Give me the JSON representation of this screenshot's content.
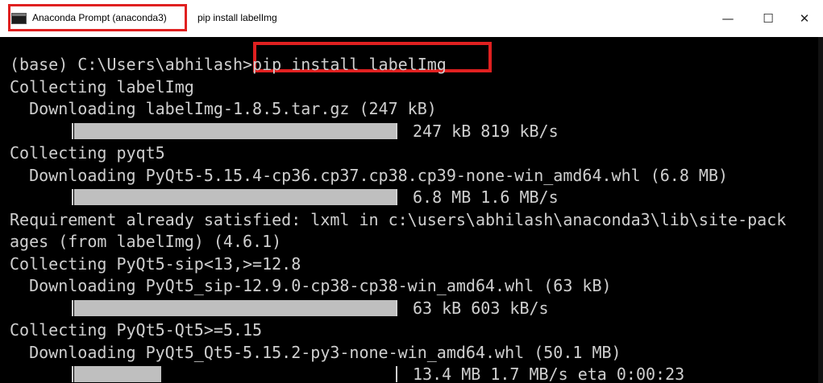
{
  "window": {
    "tab_title": "Anaconda Prompt (anaconda3)",
    "subtitle": "pip  install labelImg",
    "controls": {
      "minimize": "—",
      "maximize": "☐",
      "close": "✕"
    }
  },
  "terminal": {
    "lines": [
      {
        "type": "text",
        "text": "(base) C:\\Users\\abhilash>pip install labelImg"
      },
      {
        "type": "text",
        "text": "Collecting labelImg"
      },
      {
        "type": "text",
        "text": "  Downloading labelImg-1.8.5.tar.gz (247 kB)"
      },
      {
        "type": "progress",
        "fill": 1.0,
        "info": "247 kB 819 kB/s"
      },
      {
        "type": "text",
        "text": "Collecting pyqt5"
      },
      {
        "type": "text",
        "text": "  Downloading PyQt5-5.15.4-cp36.cp37.cp38.cp39-none-win_amd64.whl (6.8 MB)"
      },
      {
        "type": "progress",
        "fill": 1.0,
        "info": "6.8 MB 1.6 MB/s"
      },
      {
        "type": "text",
        "text": "Requirement already satisfied: lxml in c:\\users\\abhilash\\anaconda3\\lib\\site-pack"
      },
      {
        "type": "text",
        "text": "ages (from labelImg) (4.6.1)"
      },
      {
        "type": "text",
        "text": "Collecting PyQt5-sip<13,>=12.8"
      },
      {
        "type": "text",
        "text": "  Downloading PyQt5_sip-12.9.0-cp38-cp38-win_amd64.whl (63 kB)"
      },
      {
        "type": "progress",
        "fill": 1.0,
        "info": "63 kB 603 kB/s"
      },
      {
        "type": "text",
        "text": "Collecting PyQt5-Qt5>=5.15"
      },
      {
        "type": "text",
        "text": "  Downloading PyQt5_Qt5-5.15.2-py3-none-win_amd64.whl (50.1 MB)"
      },
      {
        "type": "progress",
        "fill": 0.27,
        "info": "13.4 MB 1.7 MB/s eta 0:00:23"
      }
    ]
  },
  "colors": {
    "highlight": "#e02020",
    "terminal_bg": "#000000",
    "terminal_fg": "#cfcfcf",
    "bar": "#bfbfbf"
  }
}
